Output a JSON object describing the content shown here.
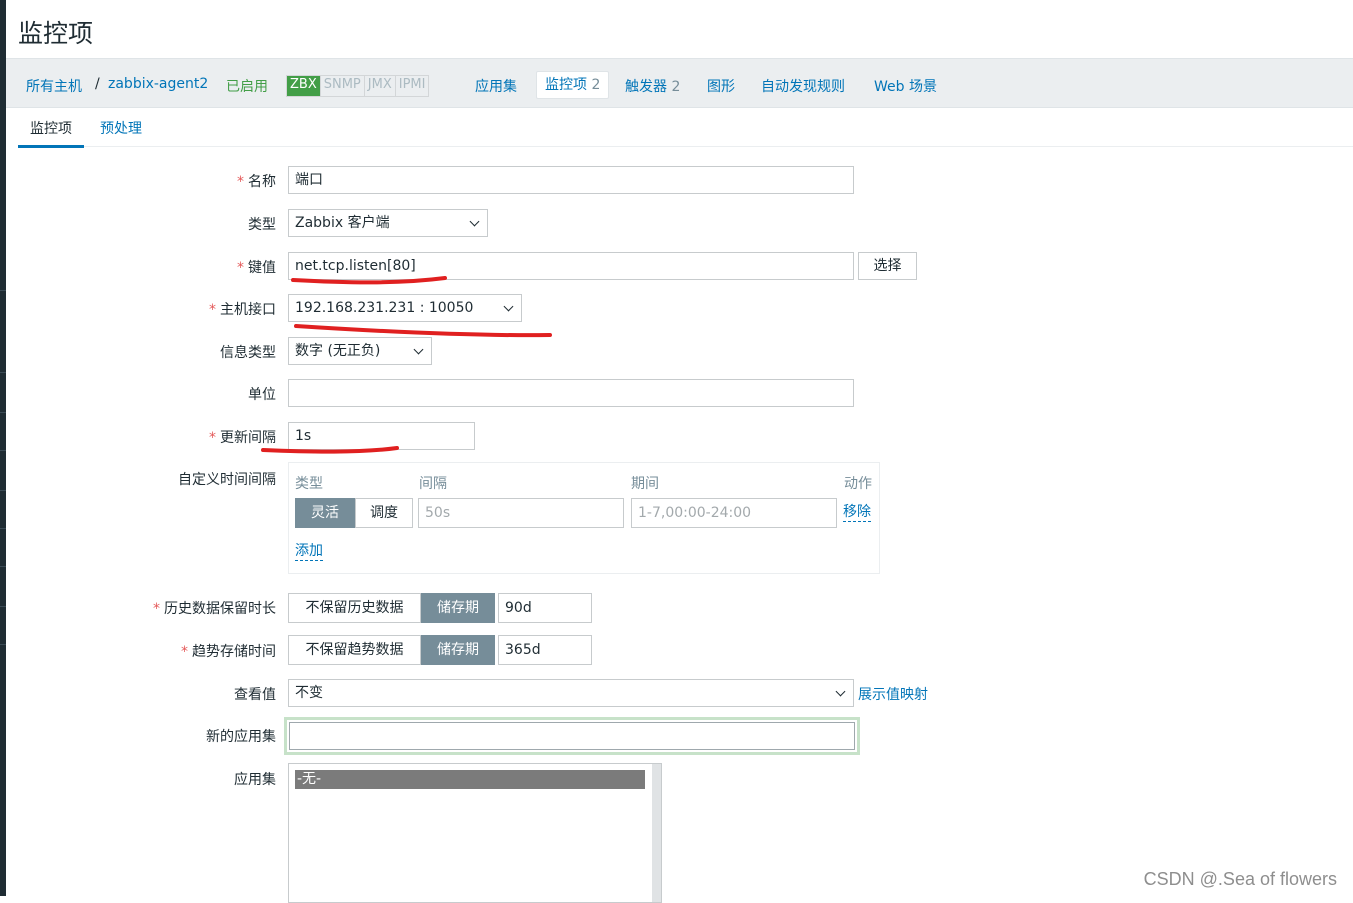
{
  "page": {
    "title": "监控项"
  },
  "breadcrumb": {
    "all_hosts": "所有主机",
    "separator": "/",
    "host": "zabbix-agent2",
    "status": "已启用",
    "availability": [
      "ZBX",
      "SNMP",
      "JMX",
      "IPMI"
    ],
    "links": {
      "applications": "应用集",
      "items": "监控项",
      "items_count": "2",
      "triggers": "触发器",
      "triggers_count": "2",
      "graphs": "图形",
      "discovery": "自动发现规则",
      "web": "Web 场景"
    }
  },
  "tabs": [
    "监控项",
    "预处理"
  ],
  "form": {
    "required_mark": "*",
    "name": {
      "label": "名称",
      "value": "端口"
    },
    "type": {
      "label": "类型",
      "value": "Zabbix 客户端"
    },
    "key": {
      "label": "键值",
      "value": "net.tcp.listen[80]",
      "button": "选择"
    },
    "interface": {
      "label": "主机接口",
      "value": "192.168.231.231 : 10050"
    },
    "info_type": {
      "label": "信息类型",
      "value": "数字 (无正负)"
    },
    "units": {
      "label": "单位",
      "value": ""
    },
    "update_interval": {
      "label": "更新间隔",
      "value": "1s"
    },
    "custom_intervals": {
      "label": "自定义时间间隔",
      "headers": {
        "type": "类型",
        "interval": "间隔",
        "period": "期间",
        "action": "动作"
      },
      "row": {
        "flexible": "灵活",
        "scheduling": "调度",
        "interval_placeholder": "50s",
        "period_placeholder": "1-7,00:00-24:00",
        "remove": "移除"
      },
      "add": "添加"
    },
    "history": {
      "label": "历史数据保留时长",
      "off": "不保留历史数据",
      "on": "储存期",
      "value": "90d"
    },
    "trends": {
      "label": "趋势存储时间",
      "off": "不保留趋势数据",
      "on": "储存期",
      "value": "365d"
    },
    "show_value": {
      "label": "查看值",
      "value": "不变",
      "link": "展示值映射"
    },
    "new_application": {
      "label": "新的应用集",
      "value": ""
    },
    "applications": {
      "label": "应用集",
      "options": [
        "-无-"
      ]
    }
  },
  "watermark": "CSDN @.Sea of flowers",
  "colors": {
    "link": "#0275b8",
    "enabled": "#429e47",
    "required": "#e45959",
    "segment_active": "#768d99",
    "annotation": "#e02020"
  }
}
